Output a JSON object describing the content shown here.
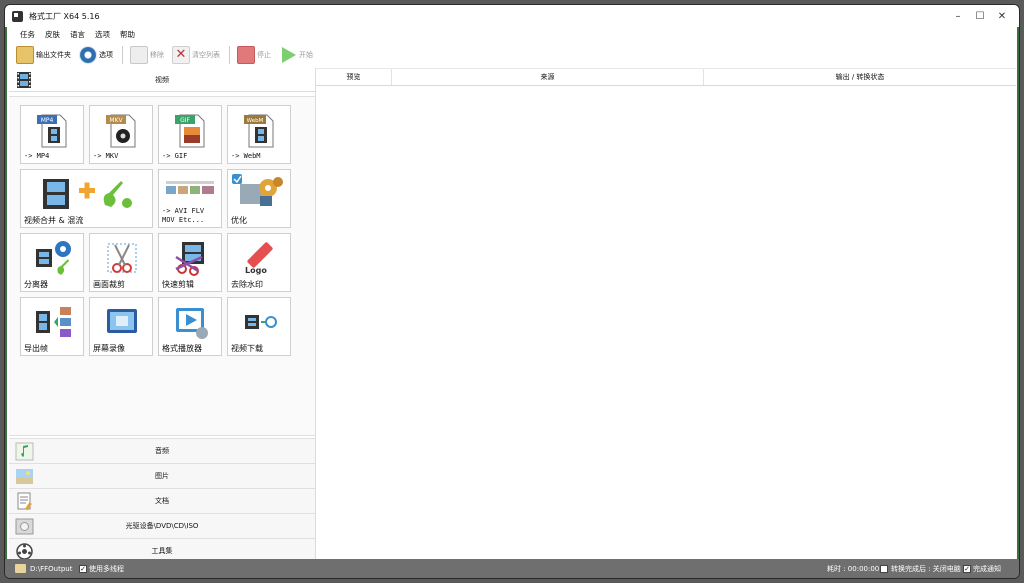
{
  "window": {
    "title": "格式工厂 X64 5.16",
    "controls": {
      "minimize": "–",
      "maximize": "☐",
      "close": "✕"
    }
  },
  "menu": [
    "任务",
    "皮肤",
    "语言",
    "选项",
    "帮助"
  ],
  "toolbar": {
    "output_folder": "输出文件夹",
    "options": "选项",
    "remove": "移除",
    "clear_list": "清空列表",
    "stop": "停止",
    "start": "开始"
  },
  "video_category": "视频",
  "video_tiles": [
    {
      "label": "-> MP4",
      "badge": "MP4",
      "icon": "mp4-file-icon"
    },
    {
      "label": "-> MKV",
      "badge": "MKV",
      "icon": "mkv-file-icon"
    },
    {
      "label": "-> GIF",
      "badge": "GIF",
      "icon": "gif-file-icon"
    },
    {
      "label": "-> WebM",
      "badge": "WebM",
      "icon": "webm-file-icon"
    },
    {
      "label": "视频合并 & 混流",
      "icon": "merge-mux-icon"
    },
    {
      "label": "-> AVI FLV\nMOV Etc...",
      "icon": "other-formats-icon"
    },
    {
      "label": "优化",
      "icon": "optimize-gears-icon"
    },
    {
      "label": "分离器",
      "icon": "splitter-icon"
    },
    {
      "label": "画面裁剪",
      "icon": "crop-scissors-icon"
    },
    {
      "label": "快速剪辑",
      "icon": "quick-clip-icon"
    },
    {
      "label": "去除水印",
      "icon": "remove-watermark-icon"
    },
    {
      "label": "导出帧",
      "icon": "export-frames-icon"
    },
    {
      "label": "屏幕录像",
      "icon": "screen-record-icon"
    },
    {
      "label": "格式播放器",
      "icon": "format-player-icon"
    },
    {
      "label": "视频下载",
      "icon": "video-download-icon"
    }
  ],
  "other_categories": [
    {
      "label": "音频",
      "icon": "audio-note-icon"
    },
    {
      "label": "图片",
      "icon": "picture-icon"
    },
    {
      "label": "文档",
      "icon": "document-icon"
    },
    {
      "label": "光驱设备\\DVD\\CD\\ISO",
      "icon": "disc-drive-icon"
    },
    {
      "label": "工具集",
      "icon": "toolbox-icon"
    }
  ],
  "table_headers": [
    "预览",
    "来源",
    "输出 / 转换状态"
  ],
  "status": {
    "output_path": "D:\\FFOutput",
    "multithread": "使用多线程",
    "elapsed": "耗时 : 00:00:00",
    "after_convert": "转换完成后 : 关闭电脑",
    "notify": "完成通知"
  },
  "colors": {
    "accent_green": "#46b33c",
    "status_bg": "#6f6f6f",
    "stop_red": "#e07a7a"
  }
}
